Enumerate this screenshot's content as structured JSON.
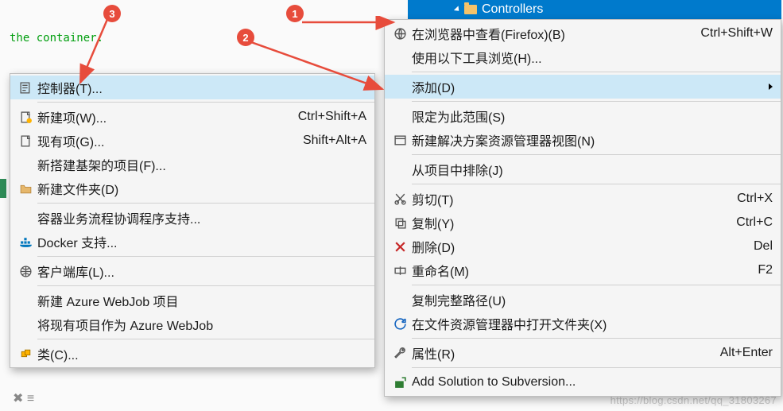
{
  "code": "the container.",
  "badges": {
    "b1": "1",
    "b2": "2",
    "b3": "3"
  },
  "solution_item": "Controllers",
  "right_menu": {
    "view_browser": {
      "label": "在浏览器中查看(Firefox)(B)",
      "shortcut": "Ctrl+Shift+W"
    },
    "browse_with": {
      "label": "使用以下工具浏览(H)..."
    },
    "add": {
      "label": "添加(D)"
    },
    "scope": {
      "label": "限定为此范围(S)"
    },
    "new_sln_view": {
      "label": "新建解决方案资源管理器视图(N)"
    },
    "exclude": {
      "label": "从项目中排除(J)"
    },
    "cut": {
      "label": "剪切(T)",
      "shortcut": "Ctrl+X"
    },
    "copy": {
      "label": "复制(Y)",
      "shortcut": "Ctrl+C"
    },
    "delete": {
      "label": "删除(D)",
      "shortcut": "Del"
    },
    "rename": {
      "label": "重命名(M)",
      "shortcut": "F2"
    },
    "copy_path": {
      "label": "复制完整路径(U)"
    },
    "open_explorer": {
      "label": "在文件资源管理器中打开文件夹(X)"
    },
    "properties": {
      "label": "属性(R)",
      "shortcut": "Alt+Enter"
    },
    "add_svn": {
      "label": "Add Solution to Subversion..."
    }
  },
  "left_menu": {
    "controller": {
      "label": "控制器(T)..."
    },
    "new_item": {
      "label": "新建项(W)...",
      "shortcut": "Ctrl+Shift+A"
    },
    "existing_item": {
      "label": "现有项(G)...",
      "shortcut": "Shift+Alt+A"
    },
    "scaffold": {
      "label": "新搭建基架的项目(F)..."
    },
    "new_folder": {
      "label": "新建文件夹(D)"
    },
    "container_orch": {
      "label": "容器业务流程协调程序支持..."
    },
    "docker": {
      "label": "Docker 支持..."
    },
    "client_lib": {
      "label": "客户端库(L)..."
    },
    "new_webjob": {
      "label": "新建 Azure WebJob 项目"
    },
    "existing_webjob": {
      "label": "将现有项目作为 Azure WebJob"
    },
    "class": {
      "label": "类(C)..."
    }
  },
  "watermark": "https://blog.csdn.net/qq_31803267"
}
